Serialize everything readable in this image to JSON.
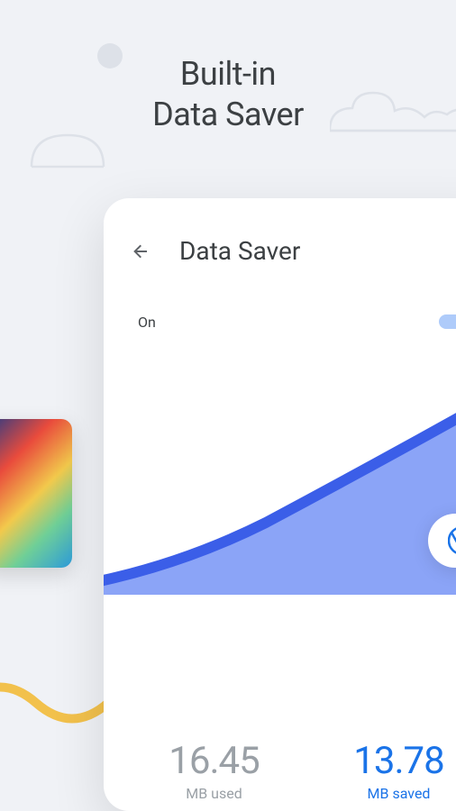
{
  "hero": {
    "line1": "Built-in",
    "line2": "Data Saver"
  },
  "phone": {
    "screen_title": "Data Saver",
    "toggle_label": "On",
    "stats": {
      "used": {
        "value": "16.45",
        "label": "MB used"
      },
      "saved": {
        "value": "13.78",
        "label": "MB saved"
      }
    }
  },
  "colors": {
    "primary": "#1a73e8",
    "chart_fill": "#8ba4f7",
    "chart_stroke": "#3b5ee8"
  }
}
